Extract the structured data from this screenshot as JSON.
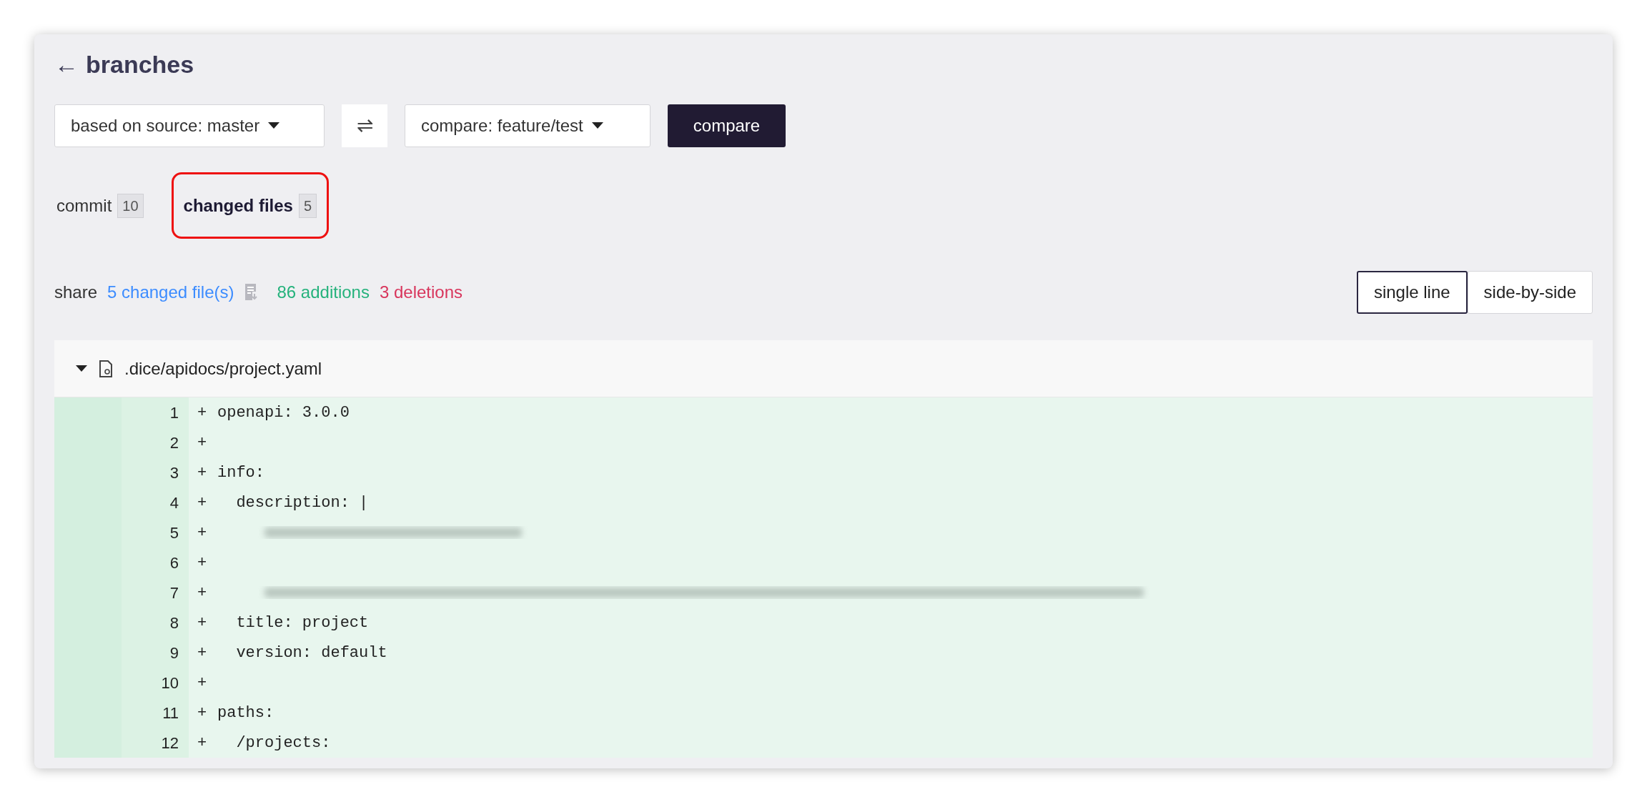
{
  "header": {
    "back": "←",
    "title": "branches"
  },
  "toolbar": {
    "source": "based on source: master",
    "swap": "⇌",
    "target": "compare: feature/test",
    "button": "compare"
  },
  "tabs": [
    {
      "label": "commit",
      "count": "10",
      "selected": false,
      "highlighted": false
    },
    {
      "label": "changed files",
      "count": "5",
      "selected": true,
      "highlighted": true
    }
  ],
  "summary": {
    "label": "share",
    "files": "5 changed file(s)",
    "additions": "86 additions",
    "deletions": "3 deletions"
  },
  "view_modes": [
    {
      "label": "single line",
      "selected": true
    },
    {
      "label": "side-by-side",
      "selected": false
    }
  ],
  "file": {
    "name": ".dice/apidocs/project.yaml",
    "expanded": true,
    "lines": [
      {
        "number": "1",
        "sign": "+",
        "kind": "code",
        "text": "openapi: 3.0.0"
      },
      {
        "number": "2",
        "sign": "+",
        "kind": "code"
      },
      {
        "number": "3",
        "sign": "+",
        "kind": "code",
        "text": "info:"
      },
      {
        "number": "4",
        "sign": "+",
        "kind": "code",
        "text": "  description: |"
      },
      {
        "number": "5",
        "sign": "+",
        "kind": "redacted"
      },
      {
        "number": "6",
        "sign": "+",
        "kind": "code"
      },
      {
        "number": "7",
        "sign": "+",
        "kind": "redacted"
      },
      {
        "number": "8",
        "sign": "+",
        "kind": "code",
        "text": "  title: project"
      },
      {
        "number": "9",
        "sign": "+",
        "kind": "code",
        "text": "  version: default"
      },
      {
        "number": "10",
        "sign": "+",
        "kind": "code"
      },
      {
        "number": "11",
        "sign": "+",
        "kind": "code",
        "text": "paths:"
      },
      {
        "number": "12",
        "sign": "+",
        "kind": "code",
        "text": "  /projects:"
      }
    ]
  }
}
